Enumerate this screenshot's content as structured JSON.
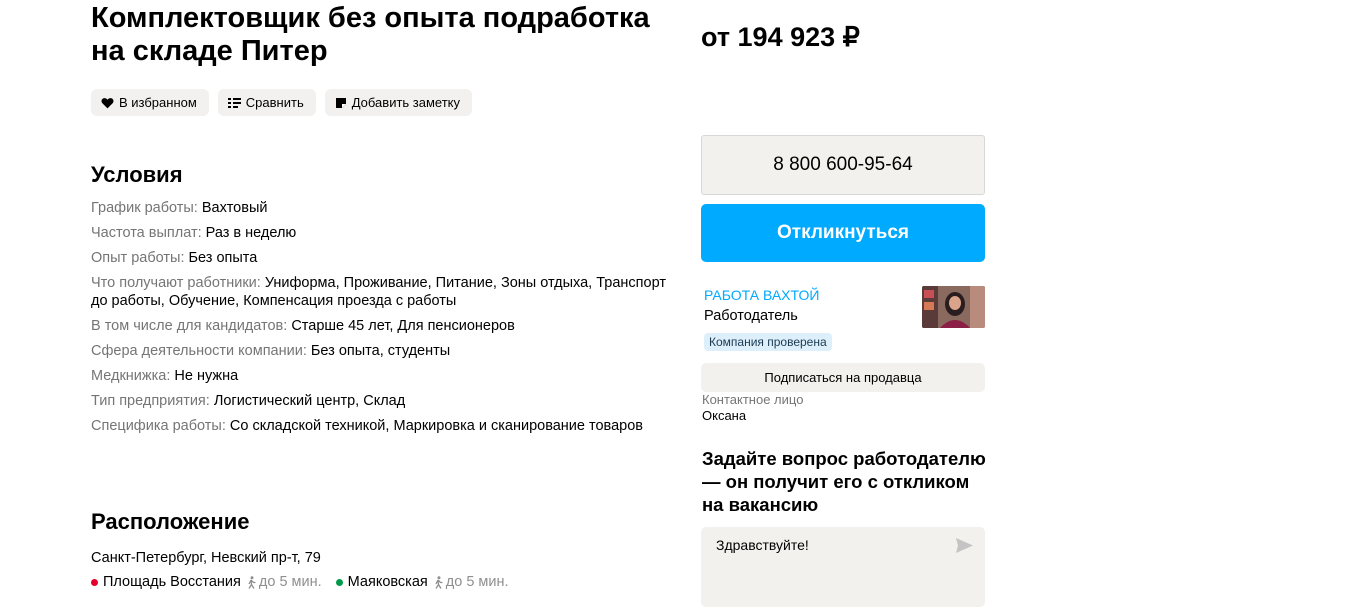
{
  "vacancy": {
    "title": "Комплектовщик без опыта подработка на складе Питер",
    "price": "от 194 923 ₽"
  },
  "actions": {
    "favorite": "В избранном",
    "compare": "Сравнить",
    "note": "Добавить заметку"
  },
  "conditions": {
    "heading": "Условия",
    "items": [
      {
        "key": "График работы: ",
        "value": "Вахтовый"
      },
      {
        "key": "Частота выплат: ",
        "value": "Раз в неделю"
      },
      {
        "key": "Опыт работы: ",
        "value": "Без опыта"
      },
      {
        "key": "Что получают работники: ",
        "value": "Униформа, Проживание, Питание, Зоны отдыха, Транспорт до работы, Обучение, Компенсация проезда с работы"
      },
      {
        "key": "В том числе для кандидатов: ",
        "value": "Старше 45 лет, Для пенсионеров"
      },
      {
        "key": "Сфера деятельности компании: ",
        "value": "Без опыта, студенты"
      },
      {
        "key": "Медкнижка: ",
        "value": "Не нужна"
      },
      {
        "key": "Тип предприятия: ",
        "value": "Логистический центр, Склад"
      },
      {
        "key": "Специфика работы: ",
        "value": "Со складской техникой, Маркировка и сканирование товаров"
      }
    ]
  },
  "location": {
    "heading": "Расположение",
    "address": "Санкт-Петербург, Невский пр-т, 79",
    "metro": [
      {
        "name": "Площадь Восстания",
        "time": "до 5 мин.",
        "color": "#e4002b"
      },
      {
        "name": "Маяковская",
        "time": "до 5 мин.",
        "color": "#009a49"
      }
    ]
  },
  "seller": {
    "phone": "8 800 600-95-64",
    "respond": "Откликнуться",
    "company": "РАБОТА ВАХТОЙ",
    "role": "Работодатель",
    "verified": "Компания проверена",
    "subscribe": "Подписаться на продавца",
    "contact_label": "Контактное лицо",
    "contact_name": "Оксана"
  },
  "question": {
    "heading": "Задайте вопрос работодателю — он получит его с откликом на вакансию",
    "message": "Здравствуйте!"
  },
  "colors": {
    "accent": "#00aaff",
    "verified_bg": "#dceffb"
  }
}
